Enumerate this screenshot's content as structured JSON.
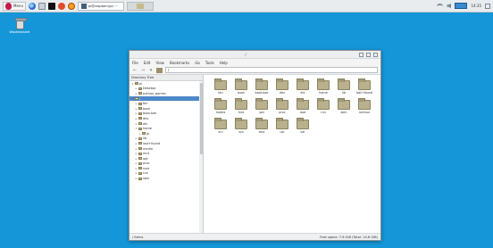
{
  "taskbar": {
    "menu_label": "Menu",
    "task_label": "pi@raspberrypi: ~",
    "clock": "14:35"
  },
  "desktop": {
    "icons": [
      {
        "label": "Wastebasket",
        "icon": "trash-icon"
      }
    ]
  },
  "window": {
    "title": "/",
    "menu": [
      "File",
      "Edit",
      "View",
      "Bookmarks",
      "Go",
      "Tools",
      "Help"
    ],
    "path": "/",
    "tree_header": "Directory Tree",
    "tree": [
      {
        "label": "pi",
        "indent": 0,
        "arrow": "▾",
        "selected": false
      },
      {
        "label": "Desktop",
        "indent": 1,
        "arrow": "▸",
        "selected": false
      },
      {
        "label": "python_games",
        "indent": 1,
        "arrow": "▸",
        "selected": false
      },
      {
        "label": "/",
        "indent": 0,
        "arrow": "▾",
        "selected": true
      },
      {
        "label": "bin",
        "indent": 1,
        "arrow": "▸",
        "selected": false
      },
      {
        "label": "boot",
        "indent": 1,
        "arrow": "▸",
        "selected": false
      },
      {
        "label": "boot.bak",
        "indent": 1,
        "arrow": "▸",
        "selected": false
      },
      {
        "label": "dev",
        "indent": 1,
        "arrow": "▸",
        "selected": false
      },
      {
        "label": "etc",
        "indent": 1,
        "arrow": "▸",
        "selected": false
      },
      {
        "label": "home",
        "indent": 1,
        "arrow": "▾",
        "selected": false
      },
      {
        "label": "pi",
        "indent": 2,
        "arrow": "▸",
        "selected": false
      },
      {
        "label": "lib",
        "indent": 1,
        "arrow": "▸",
        "selected": false
      },
      {
        "label": "lost+found",
        "indent": 1,
        "arrow": "▸",
        "selected": false
      },
      {
        "label": "media",
        "indent": 1,
        "arrow": "▸",
        "selected": false
      },
      {
        "label": "mnt",
        "indent": 1,
        "arrow": "▸",
        "selected": false
      },
      {
        "label": "opt",
        "indent": 1,
        "arrow": "▸",
        "selected": false
      },
      {
        "label": "proc",
        "indent": 1,
        "arrow": "▸",
        "selected": false
      },
      {
        "label": "root",
        "indent": 1,
        "arrow": "▸",
        "selected": false
      },
      {
        "label": "run",
        "indent": 1,
        "arrow": "▸",
        "selected": false
      },
      {
        "label": "sbin",
        "indent": 1,
        "arrow": "▸",
        "selected": false
      }
    ],
    "files": [
      "bin",
      "boot",
      "boot.bak",
      "dev",
      "etc",
      "home",
      "lib",
      "lost+found",
      "media",
      "mnt",
      "opt",
      "proc",
      "root",
      "run",
      "sbin",
      "selinux",
      "srv",
      "sys",
      "tmp",
      "usr",
      "var"
    ],
    "status_left": "/ items",
    "status_right": "Free space: 7.6 GiB (Total: 14.6 GiB)"
  }
}
